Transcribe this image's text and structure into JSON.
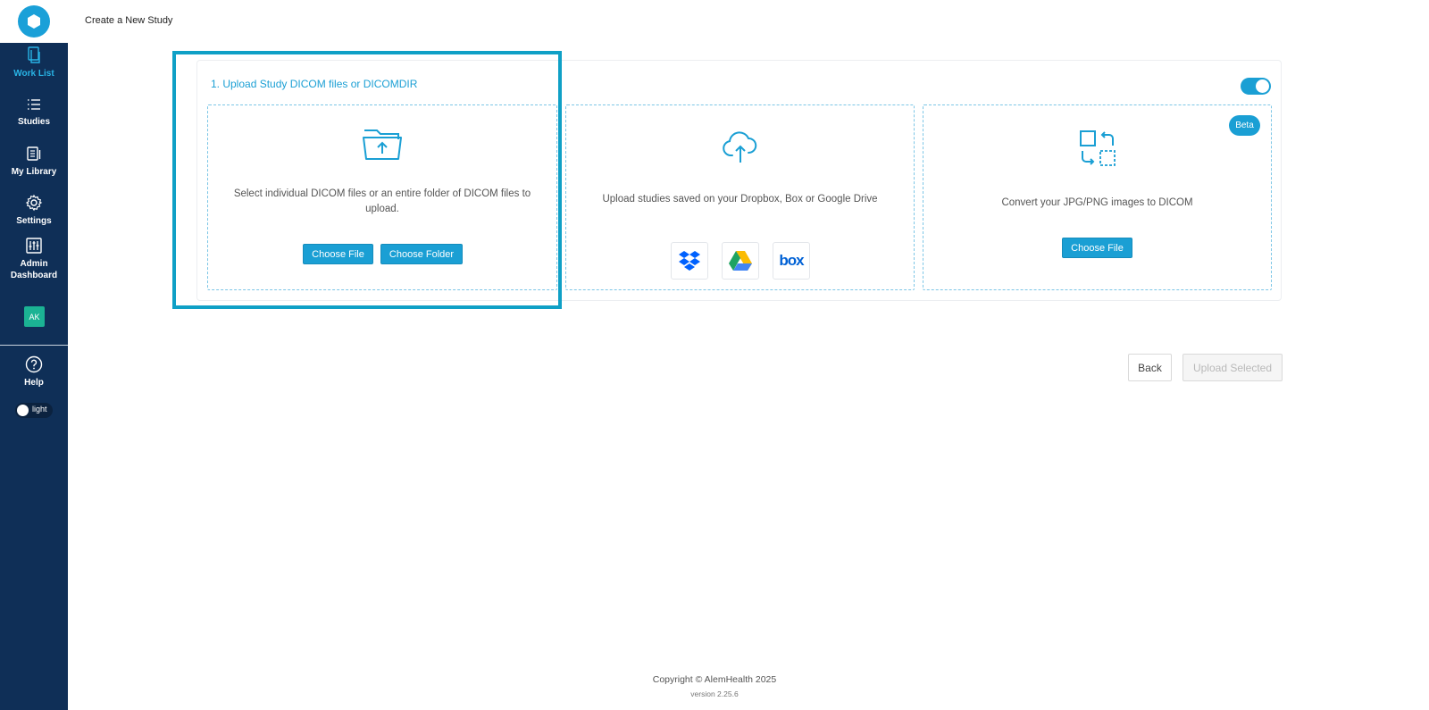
{
  "app": {
    "page_title": "Create a New Study"
  },
  "sidebar": {
    "items": [
      {
        "label": "Work List",
        "icon": "worklist-icon",
        "active": true
      },
      {
        "label": "Studies",
        "icon": "list-icon"
      },
      {
        "label": "My Library",
        "icon": "library-icon"
      },
      {
        "label": "Settings",
        "icon": "gear-icon"
      },
      {
        "label": "Admin Dashboard",
        "icon": "sliders-icon"
      }
    ],
    "avatar_initials": "AK",
    "help_label": "Help",
    "theme_label": "light"
  },
  "upload": {
    "step_title": "1. Upload Study DICOM files or DICOMDIR",
    "local": {
      "description": "Select individual DICOM files or an entire folder of DICOM files to upload.",
      "choose_file": "Choose File",
      "choose_folder": "Choose Folder"
    },
    "cloud": {
      "description": "Upload studies saved on your Dropbox, Box or Google Drive",
      "providers": [
        "dropbox-icon",
        "google-drive-icon",
        "box-icon"
      ],
      "box_text": "box"
    },
    "convert": {
      "badge": "Beta",
      "description": "Convert your JPG/PNG images to DICOM",
      "choose_file": "Choose File"
    }
  },
  "actions": {
    "back": "Back",
    "upload_selected": "Upload Selected"
  },
  "footer": {
    "copyright": "Copyright © AlemHealth 2025",
    "version": "version 2.25.6"
  },
  "colors": {
    "sidebar": "#0f2f57",
    "accent": "#1a9fd4",
    "highlight": "#0fa0c6",
    "avatar": "#1bb394"
  }
}
